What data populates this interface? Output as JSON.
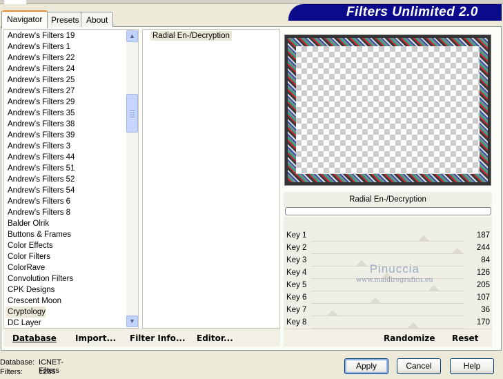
{
  "app": {
    "banner": "Filters Unlimited 2.0"
  },
  "tabs": [
    {
      "label": "Navigator",
      "active": true
    },
    {
      "label": "Presets",
      "active": false
    },
    {
      "label": "About",
      "active": false
    }
  ],
  "categories": [
    "Andrew's Filters 19",
    "Andrew's Filters 1",
    "Andrew's Filters 22",
    "Andrew's Filters 24",
    "Andrew's Filters 25",
    "Andrew's Filters 27",
    "Andrew's Filters 29",
    "Andrew's Filters 35",
    "Andrew's Filters 38",
    "Andrew's Filters 39",
    "Andrew's Filters 3",
    "Andrew's Filters 44",
    "Andrew's Filters 51",
    "Andrew's Filters 52",
    "Andrew's Filters 54",
    "Andrew's Filters 6",
    "Andrew's Filters 8",
    "Balder Olrik",
    "Buttons & Frames",
    "Color Effects",
    "Color Filters",
    "ColorRave",
    "Convolution Filters",
    "CPK Designs",
    "Crescent Moon",
    "Cryptology",
    "DC Layer"
  ],
  "selected_category_index": 25,
  "filters": [
    "Radial En-/Decryption"
  ],
  "selected_filter": "Radial En-/Decryption",
  "keys": [
    {
      "label": "Key 1",
      "value": "187",
      "level": 187
    },
    {
      "label": "Key 2",
      "value": "244",
      "level": 244
    },
    {
      "label": "Key 3",
      "value": "84",
      "level": 84
    },
    {
      "label": "Key 4",
      "value": "126",
      "level": 126
    },
    {
      "label": "Key 5",
      "value": "205",
      "level": 205
    },
    {
      "label": "Key 6",
      "value": "107",
      "level": 107
    },
    {
      "label": "Key 7",
      "value": "36",
      "level": 36
    },
    {
      "label": "Key 8",
      "value": "170",
      "level": 170
    }
  ],
  "bottom_left": {
    "database": "Database",
    "import": "Import...",
    "filter_info": "Filter Info...",
    "editor": "Editor..."
  },
  "bottom_right": {
    "randomize": "Randomize",
    "reset": "Reset"
  },
  "status": {
    "database_label": "Database:",
    "database_value": "ICNET-Filters",
    "filters_label": "Filters:",
    "filters_value": "1285"
  },
  "buttons": {
    "apply": "Apply",
    "cancel": "Cancel",
    "help": "Help"
  },
  "watermark": {
    "line1": "Pinuccia",
    "line2": "www.maidiregrafica.eu"
  },
  "colors": {
    "banner": "#0b0a8a",
    "tab_accent": "#e68b2c",
    "scroll": "#c1d3fb"
  }
}
